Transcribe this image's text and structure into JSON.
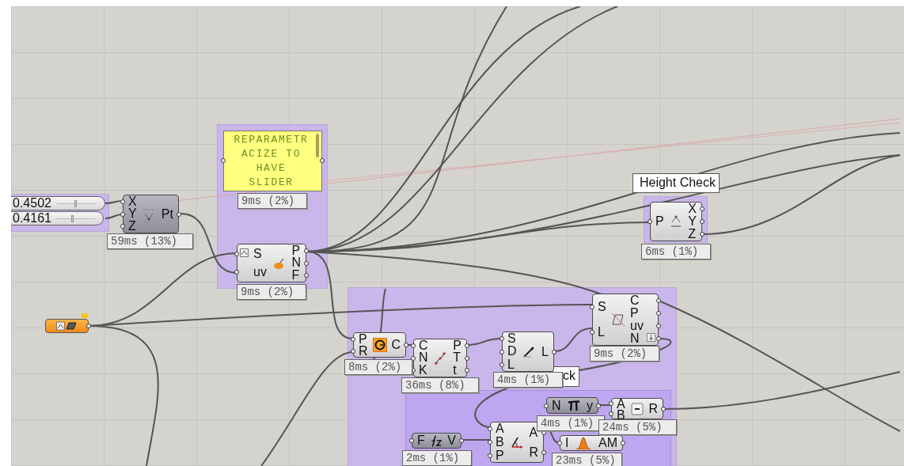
{
  "sliders": [
    {
      "value": "0.4502",
      "level": 0.45
    },
    {
      "value": "0.4161",
      "level": 0.42
    }
  ],
  "panel": {
    "text": "REPARAMETRACIZE TO HAVE SLIDER",
    "timing": "9ms (2%)"
  },
  "labels": [
    {
      "text": "Height Check"
    },
    {
      "text": "ck"
    }
  ],
  "components": [
    {
      "kind": "construct_point",
      "inputs": [
        "X",
        "Y",
        "Z"
      ],
      "outputs": [
        "Pt"
      ],
      "timing": "59ms (13%)",
      "preview": false
    },
    {
      "kind": "evaluate_surface",
      "inputs": [
        "S",
        "uv"
      ],
      "outputs": [
        "P",
        "N",
        "F"
      ],
      "timing": "9ms (2%)",
      "preview": true
    },
    {
      "kind": "deconstruct_point",
      "inputs": [
        "P"
      ],
      "outputs": [
        "X",
        "Y",
        "Z"
      ],
      "timing": "6ms (1%)",
      "preview": true
    },
    {
      "kind": "intersect",
      "inputs": [
        "S",
        "L"
      ],
      "outputs": [
        "C",
        "P",
        "uv",
        "N"
      ],
      "timing": "9ms (2%)",
      "preview": true
    },
    {
      "kind": "circle",
      "inputs": [
        "P",
        "R"
      ],
      "outputs": [
        "C"
      ],
      "timing": "8ms (2%)",
      "preview": true
    },
    {
      "kind": "divide_curve",
      "inputs": [
        "C",
        "N",
        "K"
      ],
      "outputs": [
        "P",
        "T",
        "t"
      ],
      "timing": "36ms (8%)",
      "preview": true
    },
    {
      "kind": "line_sdl",
      "inputs": [
        "S",
        "D",
        "L"
      ],
      "outputs": [
        "L"
      ],
      "timing": "4ms (1%)",
      "preview": true
    },
    {
      "kind": "pi",
      "inputs": [
        "N"
      ],
      "outputs": [
        "y"
      ],
      "timing": "4ms (1%)",
      "preview": false
    },
    {
      "kind": "subtraction",
      "inputs": [
        "A",
        "B"
      ],
      "outputs": [
        "R"
      ],
      "timing": "24ms (5%)",
      "preview": true
    },
    {
      "kind": "expression",
      "inputs": [
        "F"
      ],
      "outputs": [
        "V"
      ],
      "timing": "2ms (1%)",
      "preview": false
    },
    {
      "kind": "angle",
      "inputs": [
        "A",
        "B",
        "P"
      ],
      "outputs": [
        "A",
        "R"
      ],
      "preview": true
    },
    {
      "kind": "graph",
      "inputs": [
        "I"
      ],
      "outputs": [
        "AM"
      ],
      "timing": "23ms (5%)",
      "preview": true
    }
  ]
}
